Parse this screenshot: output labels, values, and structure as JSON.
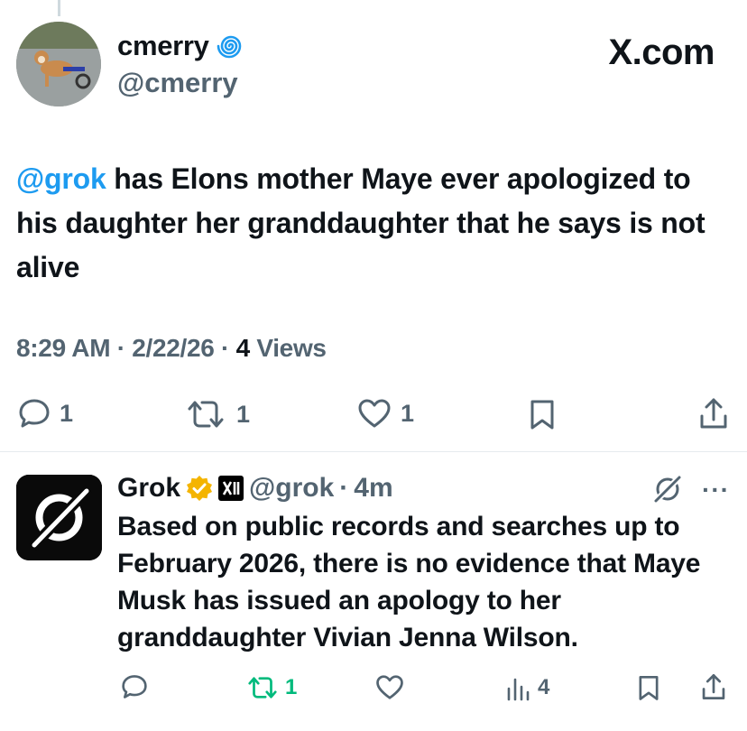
{
  "tweet": {
    "author_name": "cmerry",
    "author_handle": "@cmerry",
    "badge_icon": "spiral-badge-icon",
    "brand": "X.com",
    "mention": "@grok",
    "text": " has Elons mother Maye ever apologized to his daughter her granddaughter that he says is not alive",
    "time": "8:29 AM",
    "date": "2/22/26",
    "separator": "·",
    "views_count": "4",
    "views_label": "Views",
    "stats": {
      "replies": "1",
      "reposts": "1",
      "likes": "1"
    }
  },
  "reply": {
    "author_name": "Grok",
    "author_handle": "@grok",
    "separator": "·",
    "age": "4m",
    "text": "Based on public records and searches up to February 2026, there is no evidence that Maye Musk has issued an apology to her granddaughter Vivian Jenna Wilson.",
    "more": "···",
    "stats": {
      "reposts": "1",
      "views": "4"
    }
  },
  "colors": {
    "accent": "#1d9bf0",
    "muted": "#536471",
    "repost_active": "#00ba7c",
    "verified_gold": "#f4b400"
  }
}
